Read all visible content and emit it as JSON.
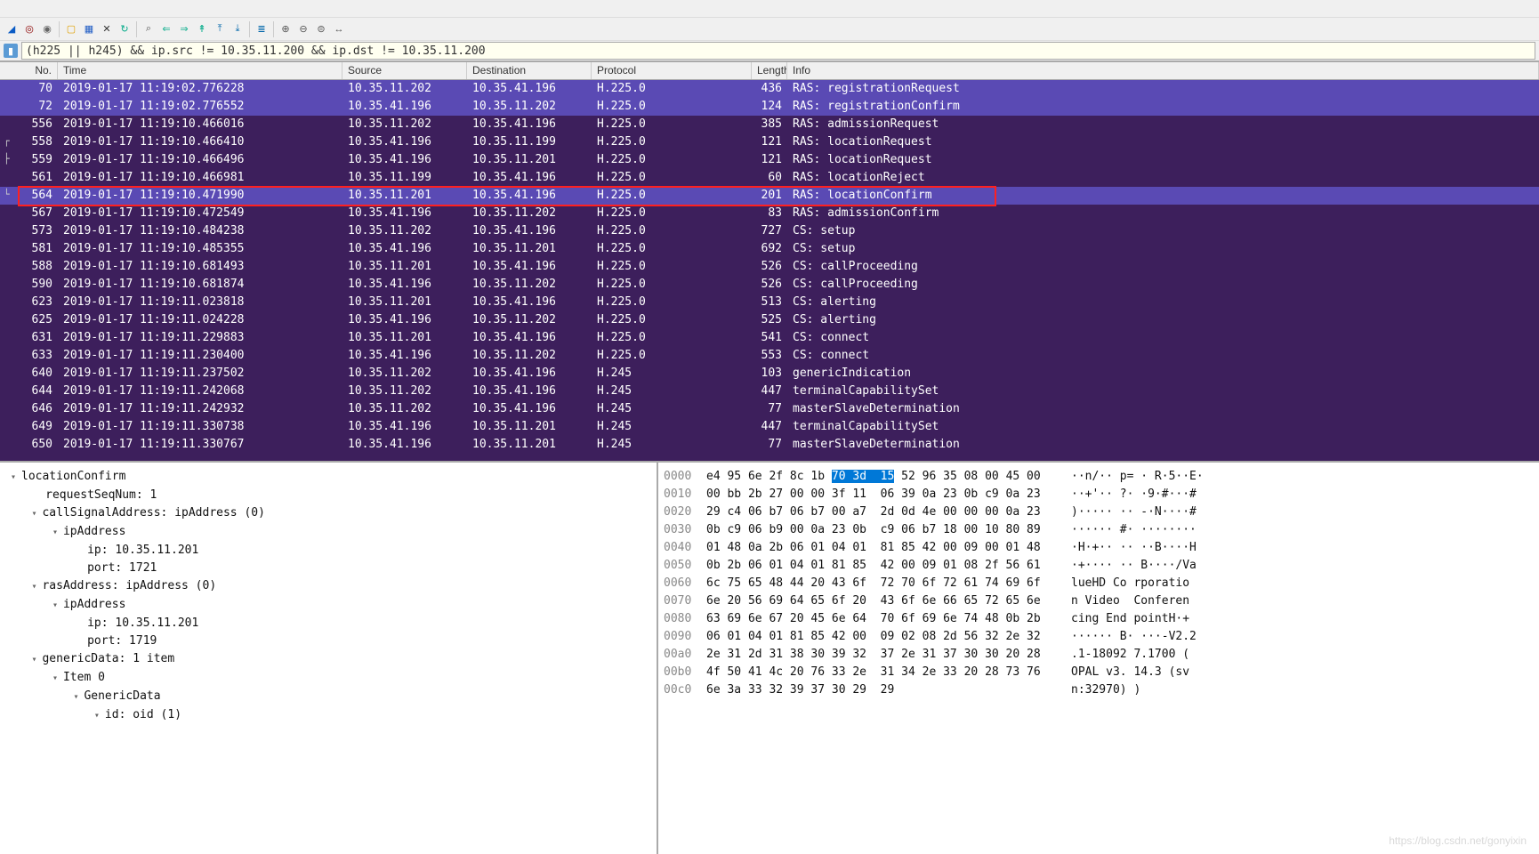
{
  "filter": {
    "text": "(h225 || h245) && ip.src != 10.35.11.200 && ip.dst != 10.35.11.200"
  },
  "headers": {
    "no": "No.",
    "time": "Time",
    "src": "Source",
    "dst": "Destination",
    "proto": "Protocol",
    "len": "Length",
    "info": "Info"
  },
  "rows": [
    {
      "no": "70",
      "time": "2019-01-17 11:19:02.776228",
      "src": "10.35.11.202",
      "dst": "10.35.41.196",
      "proto": "H.225.0",
      "len": "436",
      "info": "RAS: registrationRequest",
      "cls": "sel"
    },
    {
      "no": "72",
      "time": "2019-01-17 11:19:02.776552",
      "src": "10.35.41.196",
      "dst": "10.35.11.202",
      "proto": "H.225.0",
      "len": "124",
      "info": "RAS: registrationConfirm",
      "cls": "sel"
    },
    {
      "no": "556",
      "time": "2019-01-17 11:19:10.466016",
      "src": "10.35.11.202",
      "dst": "10.35.41.196",
      "proto": "H.225.0",
      "len": "385",
      "info": "RAS: admissionRequest"
    },
    {
      "no": "558",
      "time": "2019-01-17 11:19:10.466410",
      "src": "10.35.41.196",
      "dst": "10.35.11.199",
      "proto": "H.225.0",
      "len": "121",
      "info": "RAS: locationRequest"
    },
    {
      "no": "559",
      "time": "2019-01-17 11:19:10.466496",
      "src": "10.35.41.196",
      "dst": "10.35.11.201",
      "proto": "H.225.0",
      "len": "121",
      "info": "RAS: locationRequest"
    },
    {
      "no": "561",
      "time": "2019-01-17 11:19:10.466981",
      "src": "10.35.11.199",
      "dst": "10.35.41.196",
      "proto": "H.225.0",
      "len": "60",
      "info": "RAS: locationReject"
    },
    {
      "no": "564",
      "time": "2019-01-17 11:19:10.471990",
      "src": "10.35.11.201",
      "dst": "10.35.41.196",
      "proto": "H.225.0",
      "len": "201",
      "info": "RAS: locationConfirm",
      "cls": "sel red-box"
    },
    {
      "no": "567",
      "time": "2019-01-17 11:19:10.472549",
      "src": "10.35.41.196",
      "dst": "10.35.11.202",
      "proto": "H.225.0",
      "len": "83",
      "info": "RAS: admissionConfirm"
    },
    {
      "no": "573",
      "time": "2019-01-17 11:19:10.484238",
      "src": "10.35.11.202",
      "dst": "10.35.41.196",
      "proto": "H.225.0",
      "len": "727",
      "info": "CS: setup"
    },
    {
      "no": "581",
      "time": "2019-01-17 11:19:10.485355",
      "src": "10.35.41.196",
      "dst": "10.35.11.201",
      "proto": "H.225.0",
      "len": "692",
      "info": "CS: setup"
    },
    {
      "no": "588",
      "time": "2019-01-17 11:19:10.681493",
      "src": "10.35.11.201",
      "dst": "10.35.41.196",
      "proto": "H.225.0",
      "len": "526",
      "info": "CS: callProceeding"
    },
    {
      "no": "590",
      "time": "2019-01-17 11:19:10.681874",
      "src": "10.35.41.196",
      "dst": "10.35.11.202",
      "proto": "H.225.0",
      "len": "526",
      "info": "CS: callProceeding"
    },
    {
      "no": "623",
      "time": "2019-01-17 11:19:11.023818",
      "src": "10.35.11.201",
      "dst": "10.35.41.196",
      "proto": "H.225.0",
      "len": "513",
      "info": "CS: alerting"
    },
    {
      "no": "625",
      "time": "2019-01-17 11:19:11.024228",
      "src": "10.35.41.196",
      "dst": "10.35.11.202",
      "proto": "H.225.0",
      "len": "525",
      "info": "CS: alerting"
    },
    {
      "no": "631",
      "time": "2019-01-17 11:19:11.229883",
      "src": "10.35.11.201",
      "dst": "10.35.41.196",
      "proto": "H.225.0",
      "len": "541",
      "info": "CS: connect"
    },
    {
      "no": "633",
      "time": "2019-01-17 11:19:11.230400",
      "src": "10.35.41.196",
      "dst": "10.35.11.202",
      "proto": "H.225.0",
      "len": "553",
      "info": "CS: connect"
    },
    {
      "no": "640",
      "time": "2019-01-17 11:19:11.237502",
      "src": "10.35.11.202",
      "dst": "10.35.41.196",
      "proto": "H.245",
      "len": "103",
      "info": "genericIndication"
    },
    {
      "no": "644",
      "time": "2019-01-17 11:19:11.242068",
      "src": "10.35.11.202",
      "dst": "10.35.41.196",
      "proto": "H.245",
      "len": "447",
      "info": "terminalCapabilitySet"
    },
    {
      "no": "646",
      "time": "2019-01-17 11:19:11.242932",
      "src": "10.35.11.202",
      "dst": "10.35.41.196",
      "proto": "H.245",
      "len": "77",
      "info": "masterSlaveDetermination"
    },
    {
      "no": "649",
      "time": "2019-01-17 11:19:11.330738",
      "src": "10.35.41.196",
      "dst": "10.35.11.201",
      "proto": "H.245",
      "len": "447",
      "info": "terminalCapabilitySet"
    },
    {
      "no": "650",
      "time": "2019-01-17 11:19:11.330767",
      "src": "10.35.41.196",
      "dst": "10.35.11.201",
      "proto": "H.245",
      "len": "77",
      "info": "masterSlaveDetermination"
    }
  ],
  "details": {
    "l0": "locationConfirm",
    "l1": "requestSeqNum: 1",
    "l2": "callSignalAddress: ipAddress (0)",
    "l3": "ipAddress",
    "l4": "ip: 10.35.11.201",
    "l5": "port: 1721",
    "l6": "rasAddress: ipAddress (0)",
    "l7": "ipAddress",
    "l8": "ip: 10.35.11.201",
    "l9": "port: 1719",
    "l10": "genericData: 1 item",
    "l11": "Item 0",
    "l12": "GenericData",
    "l13": "id: oid (1)"
  },
  "hex": [
    {
      "off": "0000",
      "b": "e4 95 6e 2f 8c 1b ",
      "hl": "70 3d  15",
      "b2": " 52 96 35 08 00 45 00",
      "a": "··n/·· p= · R·5··E·"
    },
    {
      "off": "0010",
      "b": "00 bb 2b 27 00 00 3f 11  06 39 0a 23 0b c9 0a 23",
      "a": "··+'·· ?· ·9·#···#"
    },
    {
      "off": "0020",
      "b": "29 c4 06 b7 06 b7 00 a7  2d 0d 4e 00 00 00 0a 23",
      "a": ")····· ·· -·N····#"
    },
    {
      "off": "0030",
      "b": "0b c9 06 b9 00 0a 23 0b  c9 06 b7 18 00 10 80 89",
      "a": "······ #· ········"
    },
    {
      "off": "0040",
      "b": "01 48 0a 2b 06 01 04 01  81 85 42 00 09 00 01 48",
      "a": "·H·+·· ·· ··B····H"
    },
    {
      "off": "0050",
      "b": "0b 2b 06 01 04 01 81 85  42 00 09 01 08 2f 56 61",
      "a": "·+···· ·· B····/Va"
    },
    {
      "off": "0060",
      "b": "6c 75 65 48 44 20 43 6f  72 70 6f 72 61 74 69 6f",
      "a": "lueHD Co rporatio"
    },
    {
      "off": "0070",
      "b": "6e 20 56 69 64 65 6f 20  43 6f 6e 66 65 72 65 6e",
      "a": "n Video  Conferen"
    },
    {
      "off": "0080",
      "b": "63 69 6e 67 20 45 6e 64  70 6f 69 6e 74 48 0b 2b",
      "a": "cing End pointH·+"
    },
    {
      "off": "0090",
      "b": "06 01 04 01 81 85 42 00  09 02 08 2d 56 32 2e 32",
      "a": "······ B· ···-V2.2"
    },
    {
      "off": "00a0",
      "b": "2e 31 2d 31 38 30 39 32  37 2e 31 37 30 30 20 28",
      "a": ".1-18092 7.1700 ("
    },
    {
      "off": "00b0",
      "b": "4f 50 41 4c 20 76 33 2e  31 34 2e 33 20 28 73 76",
      "a": "OPAL v3. 14.3 (sv"
    },
    {
      "off": "00c0",
      "b": "6e 3a 33 32 39 37 30 29  29",
      "a": "n:32970) )"
    }
  ],
  "watermark": "https://blog.csdn.net/gonyixin"
}
